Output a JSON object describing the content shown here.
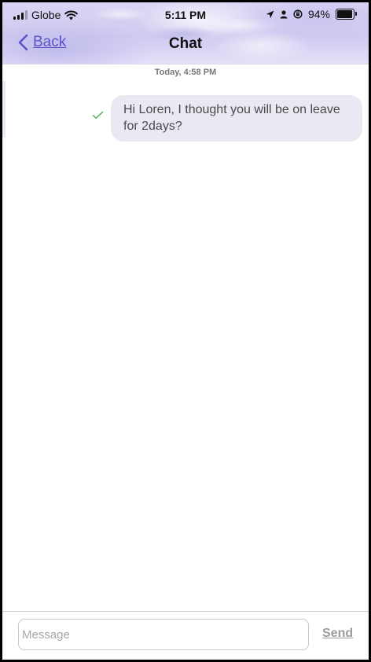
{
  "status_bar": {
    "carrier": "Globe",
    "time": "5:11 PM",
    "battery_percent": "94%",
    "battery_level": 0.94,
    "icons": [
      "signal-icon",
      "wifi-icon",
      "location-arrow-icon",
      "person-icon",
      "rotation-lock-icon",
      "battery-icon"
    ]
  },
  "nav": {
    "back_label": "Back",
    "title": "Chat"
  },
  "conversation": {
    "timestamp": "Today, 4:58 PM",
    "messages": [
      {
        "text": "Hi Loren, I thought you will be on leave for 2days?",
        "status_icon": "check-icon",
        "status_color": "#4caf50"
      }
    ]
  },
  "composer": {
    "placeholder": "Message",
    "value": "",
    "send_label": "Send"
  },
  "colors": {
    "accent": "#5a55c9",
    "bubble": "#e9e9f3"
  }
}
